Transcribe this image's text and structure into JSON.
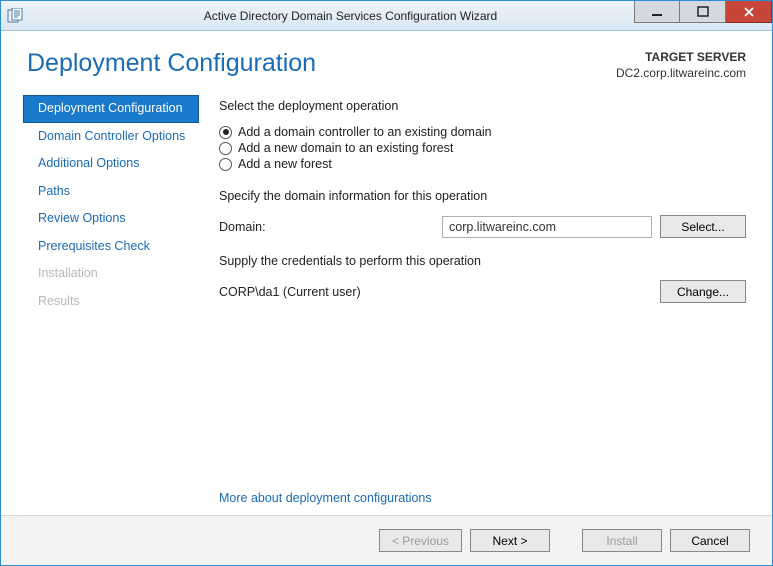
{
  "window": {
    "title": "Active Directory Domain Services Configuration Wizard"
  },
  "header": {
    "page_title": "Deployment Configuration",
    "target_label": "TARGET SERVER",
    "target_value": "DC2.corp.litwareinc.com"
  },
  "nav": {
    "items": [
      {
        "label": "Deployment Configuration",
        "state": "selected"
      },
      {
        "label": "Domain Controller Options",
        "state": "normal"
      },
      {
        "label": "Additional Options",
        "state": "normal"
      },
      {
        "label": "Paths",
        "state": "normal"
      },
      {
        "label": "Review Options",
        "state": "normal"
      },
      {
        "label": "Prerequisites Check",
        "state": "normal"
      },
      {
        "label": "Installation",
        "state": "disabled"
      },
      {
        "label": "Results",
        "state": "disabled"
      }
    ]
  },
  "main": {
    "op_label": "Select the deployment operation",
    "radios": [
      {
        "label": "Add a domain controller to an existing domain",
        "checked": true
      },
      {
        "label": "Add a new domain to an existing forest",
        "checked": false
      },
      {
        "label": "Add a new forest",
        "checked": false
      }
    ],
    "domain_section_label": "Specify the domain information for this operation",
    "domain_field_label": "Domain:",
    "domain_value": "corp.litwareinc.com",
    "select_btn": "Select...",
    "cred_section_label": "Supply the credentials to perform this operation",
    "cred_value": "CORP\\da1 (Current user)",
    "change_btn": "Change...",
    "more_link": "More about deployment configurations"
  },
  "footer": {
    "previous": "< Previous",
    "next": "Next >",
    "install": "Install",
    "cancel": "Cancel"
  }
}
